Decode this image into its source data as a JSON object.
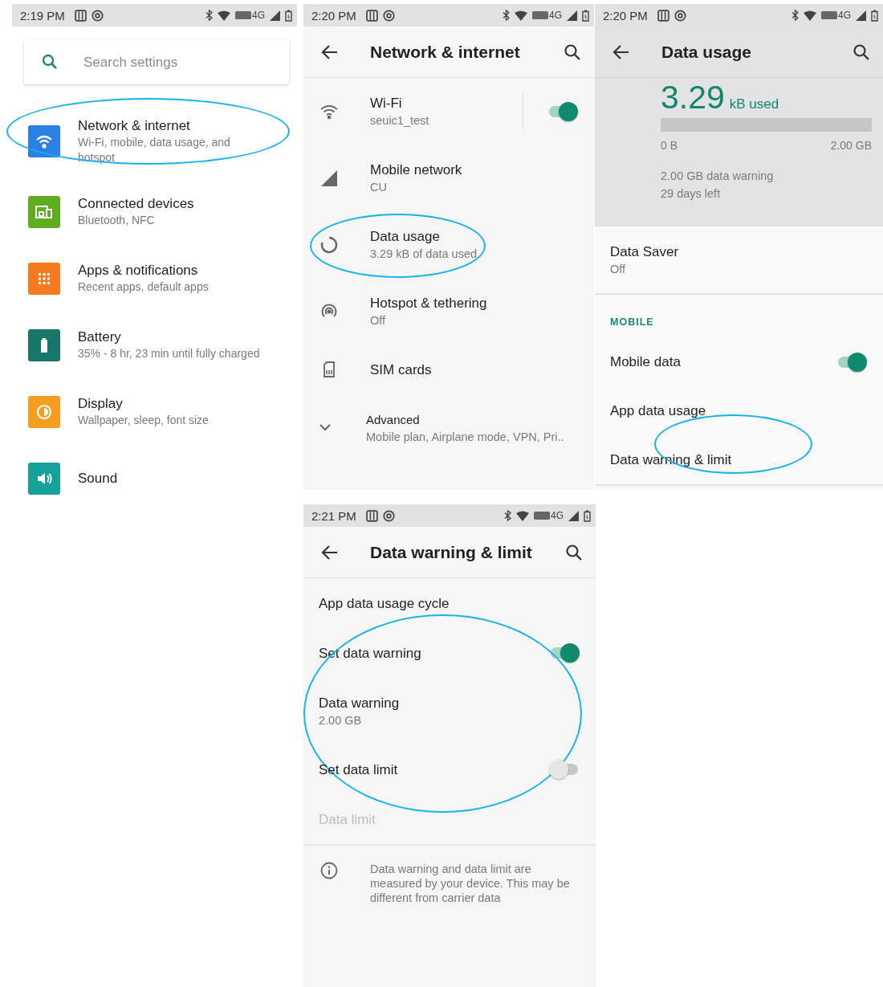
{
  "settings_screen": {
    "status_bar": {
      "time": "2:19 PM",
      "network": "4G"
    },
    "search": {
      "placeholder": "Search settings"
    },
    "items": [
      {
        "title": "Network & internet",
        "summary": "Wi-Fi, mobile, data usage, and hotspot",
        "color": "#2a80e4",
        "circled": true
      },
      {
        "title": "Connected devices",
        "summary": "Bluetooth, NFC",
        "color": "#5fae1f",
        "circled": false
      },
      {
        "title": "Apps & notifications",
        "summary": "Recent apps, default apps",
        "color": "#f57a20",
        "circled": false
      },
      {
        "title": "Battery",
        "summary": "35% - 8 hr, 23 min until fully charged",
        "color": "#17776b",
        "circled": false
      },
      {
        "title": "Display",
        "summary": "Wallpaper, sleep, font size",
        "color": "#f59d1f",
        "circled": false
      },
      {
        "title": "Sound",
        "color": "#16a29a",
        "circled": false
      }
    ]
  },
  "network_screen": {
    "status_bar": {
      "time": "2:20 PM",
      "network": "4G"
    },
    "title": "Network & internet",
    "items": [
      {
        "title": "Wi-Fi",
        "summary": "seuic1_test",
        "kind": "toggle",
        "on": true,
        "circled": false
      },
      {
        "title": "Mobile network",
        "summary": "CU",
        "kind": "plain",
        "circled": false
      },
      {
        "title": "Data usage",
        "summary": "3.29 kB of data used",
        "kind": "plain",
        "circled": true
      },
      {
        "title": "Hotspot & tethering",
        "summary": "Off",
        "kind": "plain",
        "circled": false
      },
      {
        "title": "SIM cards",
        "kind": "plain",
        "circled": false
      },
      {
        "title": "Advanced",
        "summary": "Mobile plan, Airplane mode, VPN, Pri..",
        "kind": "expander",
        "circled": false
      }
    ]
  },
  "data_usage_screen": {
    "status_bar": {
      "time": "2:20 PM",
      "network": "4G"
    },
    "title": "Data usage",
    "usage": {
      "amount": "3.29",
      "unit": "kB used",
      "level": 0,
      "min_label": "0 B",
      "max_label": "2.00 GB",
      "warning": "2.00 GB data warning",
      "days_left": "29 days left"
    },
    "data_saver": {
      "title": "Data Saver",
      "summary": "Off"
    },
    "section": "MOBILE",
    "items": [
      {
        "title": "Mobile data",
        "kind": "toggle",
        "on": true,
        "circled": false
      },
      {
        "title": "App data usage",
        "kind": "plain",
        "circled": false
      },
      {
        "title": "Data warning & limit",
        "kind": "plain",
        "circled": true
      }
    ]
  },
  "data_warning_screen": {
    "status_bar": {
      "time": "2:21 PM",
      "network": "4G"
    },
    "title": "Data warning & limit",
    "items": [
      {
        "title": "App data usage cycle",
        "kind": "plain",
        "disabled": false,
        "circled": false
      },
      {
        "title": "Set data warning",
        "kind": "toggle",
        "on": true,
        "disabled": false,
        "circled": false
      },
      {
        "title": "Data warning",
        "summary": "2.00 GB",
        "kind": "plain",
        "disabled": false,
        "circled": true
      },
      {
        "title": "Set data limit",
        "kind": "toggle",
        "on": false,
        "disabled": false,
        "circled": false
      },
      {
        "title": "Data limit",
        "kind": "plain",
        "disabled": true,
        "circled": false
      }
    ],
    "footer": "Data warning and data limit are measured by your device. This may be different from carrier data"
  }
}
